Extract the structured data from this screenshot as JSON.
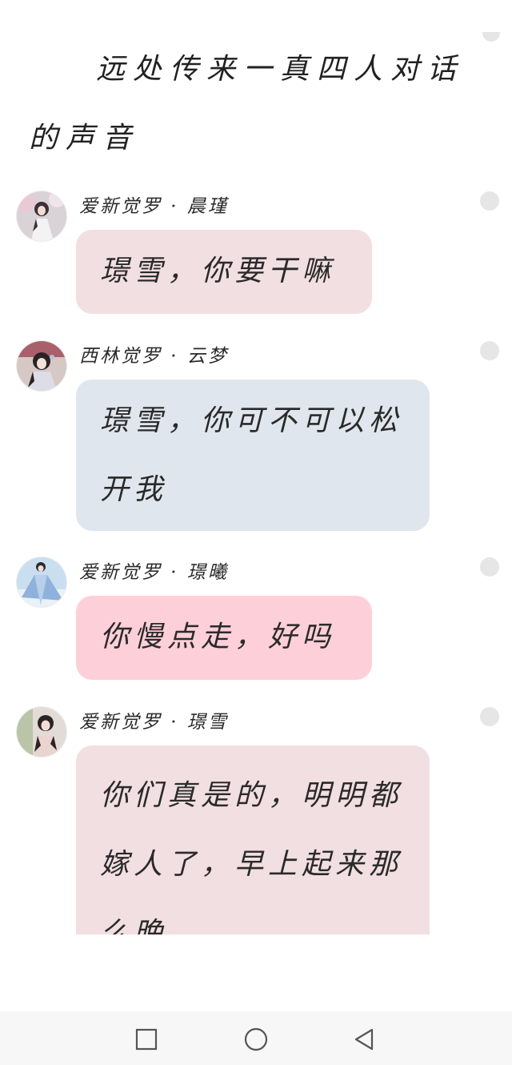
{
  "narration": "远处传来一真四人对话的声音",
  "messages": [
    {
      "sender": "爱新觉罗 · 晨瑾",
      "text": "璟雪，你要干嘛",
      "bubble_color": "#f2dfe1"
    },
    {
      "sender": "西林觉罗 · 云梦",
      "text": "璟雪，你可不可以松开我",
      "bubble_color": "#e0e6ee"
    },
    {
      "sender": "爱新觉罗 · 璟曦",
      "text": "你慢点走，好吗",
      "bubble_color": "#fdd0d9"
    },
    {
      "sender": "爱新觉罗 · 璟雪",
      "text": "你们真是的，明明都嫁人了，早上起来那么晚",
      "bubble_color": "#f2dfe1"
    }
  ],
  "nav": {
    "recents": "square-icon",
    "home": "circle-icon",
    "back": "triangle-back-icon"
  }
}
